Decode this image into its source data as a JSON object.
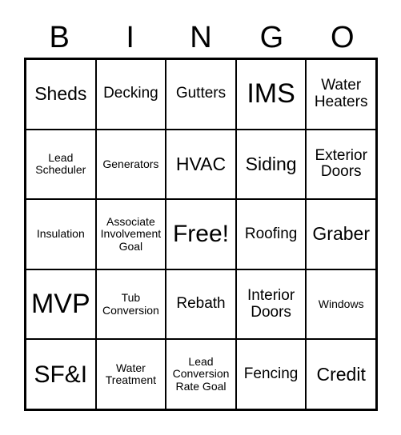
{
  "header": [
    "B",
    "I",
    "N",
    "G",
    "O"
  ],
  "cells": [
    {
      "text": "Sheds",
      "size": "s3"
    },
    {
      "text": "Decking",
      "size": "s2"
    },
    {
      "text": "Gutters",
      "size": "s2"
    },
    {
      "text": "IMS",
      "size": "s5"
    },
    {
      "text": "Water Heaters",
      "size": "s2"
    },
    {
      "text": "Lead Scheduler",
      "size": "s1"
    },
    {
      "text": "Generators",
      "size": "s1"
    },
    {
      "text": "HVAC",
      "size": "s3"
    },
    {
      "text": "Siding",
      "size": "s3"
    },
    {
      "text": "Exterior Doors",
      "size": "s2"
    },
    {
      "text": "Insulation",
      "size": "s1"
    },
    {
      "text": "Associate Involvement Goal",
      "size": "s1"
    },
    {
      "text": "Free!",
      "size": "s4"
    },
    {
      "text": "Roofing",
      "size": "s2"
    },
    {
      "text": "Graber",
      "size": "s3"
    },
    {
      "text": "MVP",
      "size": "s5"
    },
    {
      "text": "Tub Conversion",
      "size": "s1"
    },
    {
      "text": "Rebath",
      "size": "s2"
    },
    {
      "text": "Interior Doors",
      "size": "s2"
    },
    {
      "text": "Windows",
      "size": "s1"
    },
    {
      "text": "SF&I",
      "size": "s4"
    },
    {
      "text": "Water Treatment",
      "size": "s1"
    },
    {
      "text": "Lead Conversion Rate Goal",
      "size": "s1"
    },
    {
      "text": "Fencing",
      "size": "s2"
    },
    {
      "text": "Credit",
      "size": "s3"
    }
  ]
}
